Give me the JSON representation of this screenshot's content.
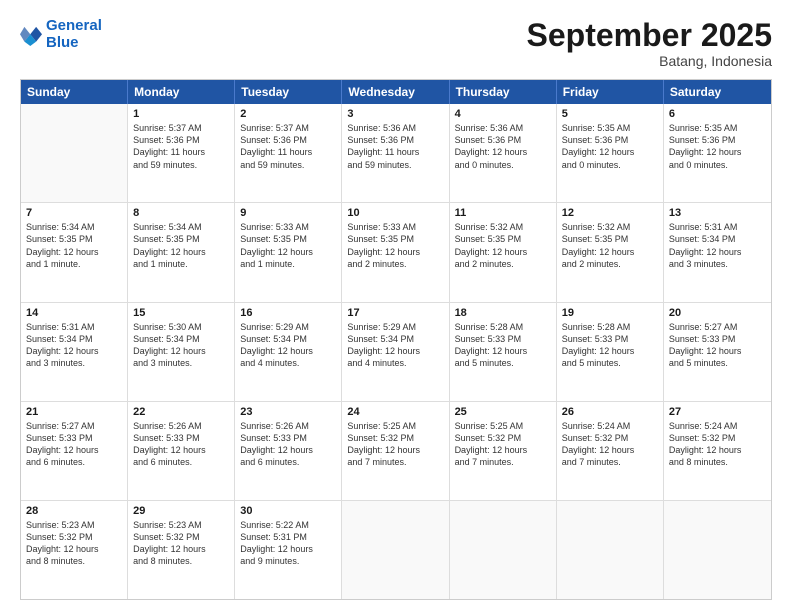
{
  "logo": {
    "line1": "General",
    "line2": "Blue"
  },
  "title": "September 2025",
  "subtitle": "Batang, Indonesia",
  "header_days": [
    "Sunday",
    "Monday",
    "Tuesday",
    "Wednesday",
    "Thursday",
    "Friday",
    "Saturday"
  ],
  "weeks": [
    [
      {
        "day": "",
        "text": ""
      },
      {
        "day": "1",
        "text": "Sunrise: 5:37 AM\nSunset: 5:36 PM\nDaylight: 11 hours\nand 59 minutes."
      },
      {
        "day": "2",
        "text": "Sunrise: 5:37 AM\nSunset: 5:36 PM\nDaylight: 11 hours\nand 59 minutes."
      },
      {
        "day": "3",
        "text": "Sunrise: 5:36 AM\nSunset: 5:36 PM\nDaylight: 11 hours\nand 59 minutes."
      },
      {
        "day": "4",
        "text": "Sunrise: 5:36 AM\nSunset: 5:36 PM\nDaylight: 12 hours\nand 0 minutes."
      },
      {
        "day": "5",
        "text": "Sunrise: 5:35 AM\nSunset: 5:36 PM\nDaylight: 12 hours\nand 0 minutes."
      },
      {
        "day": "6",
        "text": "Sunrise: 5:35 AM\nSunset: 5:36 PM\nDaylight: 12 hours\nand 0 minutes."
      }
    ],
    [
      {
        "day": "7",
        "text": "Sunrise: 5:34 AM\nSunset: 5:35 PM\nDaylight: 12 hours\nand 1 minute."
      },
      {
        "day": "8",
        "text": "Sunrise: 5:34 AM\nSunset: 5:35 PM\nDaylight: 12 hours\nand 1 minute."
      },
      {
        "day": "9",
        "text": "Sunrise: 5:33 AM\nSunset: 5:35 PM\nDaylight: 12 hours\nand 1 minute."
      },
      {
        "day": "10",
        "text": "Sunrise: 5:33 AM\nSunset: 5:35 PM\nDaylight: 12 hours\nand 2 minutes."
      },
      {
        "day": "11",
        "text": "Sunrise: 5:32 AM\nSunset: 5:35 PM\nDaylight: 12 hours\nand 2 minutes."
      },
      {
        "day": "12",
        "text": "Sunrise: 5:32 AM\nSunset: 5:35 PM\nDaylight: 12 hours\nand 2 minutes."
      },
      {
        "day": "13",
        "text": "Sunrise: 5:31 AM\nSunset: 5:34 PM\nDaylight: 12 hours\nand 3 minutes."
      }
    ],
    [
      {
        "day": "14",
        "text": "Sunrise: 5:31 AM\nSunset: 5:34 PM\nDaylight: 12 hours\nand 3 minutes."
      },
      {
        "day": "15",
        "text": "Sunrise: 5:30 AM\nSunset: 5:34 PM\nDaylight: 12 hours\nand 3 minutes."
      },
      {
        "day": "16",
        "text": "Sunrise: 5:29 AM\nSunset: 5:34 PM\nDaylight: 12 hours\nand 4 minutes."
      },
      {
        "day": "17",
        "text": "Sunrise: 5:29 AM\nSunset: 5:34 PM\nDaylight: 12 hours\nand 4 minutes."
      },
      {
        "day": "18",
        "text": "Sunrise: 5:28 AM\nSunset: 5:33 PM\nDaylight: 12 hours\nand 5 minutes."
      },
      {
        "day": "19",
        "text": "Sunrise: 5:28 AM\nSunset: 5:33 PM\nDaylight: 12 hours\nand 5 minutes."
      },
      {
        "day": "20",
        "text": "Sunrise: 5:27 AM\nSunset: 5:33 PM\nDaylight: 12 hours\nand 5 minutes."
      }
    ],
    [
      {
        "day": "21",
        "text": "Sunrise: 5:27 AM\nSunset: 5:33 PM\nDaylight: 12 hours\nand 6 minutes."
      },
      {
        "day": "22",
        "text": "Sunrise: 5:26 AM\nSunset: 5:33 PM\nDaylight: 12 hours\nand 6 minutes."
      },
      {
        "day": "23",
        "text": "Sunrise: 5:26 AM\nSunset: 5:33 PM\nDaylight: 12 hours\nand 6 minutes."
      },
      {
        "day": "24",
        "text": "Sunrise: 5:25 AM\nSunset: 5:32 PM\nDaylight: 12 hours\nand 7 minutes."
      },
      {
        "day": "25",
        "text": "Sunrise: 5:25 AM\nSunset: 5:32 PM\nDaylight: 12 hours\nand 7 minutes."
      },
      {
        "day": "26",
        "text": "Sunrise: 5:24 AM\nSunset: 5:32 PM\nDaylight: 12 hours\nand 7 minutes."
      },
      {
        "day": "27",
        "text": "Sunrise: 5:24 AM\nSunset: 5:32 PM\nDaylight: 12 hours\nand 8 minutes."
      }
    ],
    [
      {
        "day": "28",
        "text": "Sunrise: 5:23 AM\nSunset: 5:32 PM\nDaylight: 12 hours\nand 8 minutes."
      },
      {
        "day": "29",
        "text": "Sunrise: 5:23 AM\nSunset: 5:32 PM\nDaylight: 12 hours\nand 8 minutes."
      },
      {
        "day": "30",
        "text": "Sunrise: 5:22 AM\nSunset: 5:31 PM\nDaylight: 12 hours\nand 9 minutes."
      },
      {
        "day": "",
        "text": ""
      },
      {
        "day": "",
        "text": ""
      },
      {
        "day": "",
        "text": ""
      },
      {
        "day": "",
        "text": ""
      }
    ]
  ]
}
